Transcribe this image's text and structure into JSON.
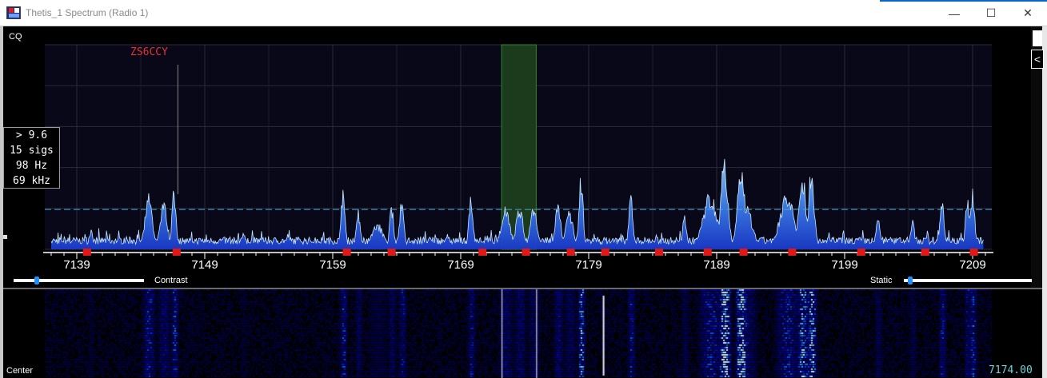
{
  "window": {
    "title": "Thetis_1 Spectrum (Radio 1)",
    "minimize_glyph": "—",
    "maximize_glyph": "☐",
    "close_glyph": "✕"
  },
  "panel": {
    "mode_label": "CQ",
    "collapse_glyph": "<",
    "callsign": "ZS6CCY",
    "center_label": "Center",
    "frequency": "7174.00"
  },
  "stats": {
    "threshold": "> 9.6",
    "signals": "15 sigs",
    "bin_width": "98 Hz",
    "span": "69 kHz"
  },
  "controls": {
    "contrast_label": "Contrast",
    "static_label": "Static",
    "contrast_value": 0.18,
    "static_value": 0.03
  },
  "colors": {
    "accent": "#1e90ff",
    "spectrum_fill": "#1a3acb",
    "spectrum_peak": "#8ed0ff",
    "passband": "#1c3a1c",
    "marker": "#e01818",
    "callsign": "#e83030",
    "readout": "#6fd0d8"
  },
  "chart_data": {
    "type": "area",
    "xlim": [
      7136.5,
      7210.5
    ],
    "ylim": [
      0,
      10
    ],
    "x_ticks": [
      7139,
      7149,
      7159,
      7169,
      7179,
      7189,
      7199,
      7209
    ],
    "passband": [
      7172.2,
      7174.9
    ],
    "threshold_line": 1.95,
    "markers": [
      7139.8,
      7146.8,
      7160.1,
      7163.6,
      7170.7,
      7174.1,
      7177.6,
      7180.3,
      7184.5,
      7188.3,
      7191.1,
      7194.9,
      7200.3,
      7205.3,
      7209.1
    ],
    "callsign_marker_x": 7146.9,
    "signals": [
      {
        "center": 7140.1,
        "width": 0.3,
        "level": 0.9
      },
      {
        "center": 7144.6,
        "width": 0.5,
        "level": 2.6
      },
      {
        "center": 7145.8,
        "width": 0.5,
        "level": 2.2
      },
      {
        "center": 7146.6,
        "width": 0.3,
        "level": 2.8
      },
      {
        "center": 7152.0,
        "width": 0.3,
        "level": 0.8
      },
      {
        "center": 7159.8,
        "width": 0.3,
        "level": 2.8
      },
      {
        "center": 7161.0,
        "width": 0.3,
        "level": 1.8
      },
      {
        "center": 7162.5,
        "width": 0.8,
        "level": 1.2
      },
      {
        "center": 7163.6,
        "width": 0.3,
        "level": 2.0
      },
      {
        "center": 7164.4,
        "width": 0.3,
        "level": 2.4
      },
      {
        "center": 7169.8,
        "width": 0.3,
        "level": 2.4
      },
      {
        "center": 7172.5,
        "width": 0.6,
        "level": 2.1
      },
      {
        "center": 7173.6,
        "width": 0.5,
        "level": 2.0
      },
      {
        "center": 7174.7,
        "width": 0.5,
        "level": 1.9
      },
      {
        "center": 7176.6,
        "width": 0.4,
        "level": 2.2
      },
      {
        "center": 7177.5,
        "width": 0.5,
        "level": 1.8
      },
      {
        "center": 7178.4,
        "width": 0.3,
        "level": 3.4
      },
      {
        "center": 7182.3,
        "width": 0.3,
        "level": 2.6
      },
      {
        "center": 7186.5,
        "width": 0.3,
        "level": 1.6
      },
      {
        "center": 7188.5,
        "width": 1.0,
        "level": 2.6
      },
      {
        "center": 7189.6,
        "width": 0.5,
        "level": 4.3
      },
      {
        "center": 7190.9,
        "width": 0.5,
        "level": 4.2
      },
      {
        "center": 7191.3,
        "width": 0.8,
        "level": 2.2
      },
      {
        "center": 7194.5,
        "width": 1.0,
        "level": 2.6
      },
      {
        "center": 7195.7,
        "width": 0.5,
        "level": 3.6
      },
      {
        "center": 7196.4,
        "width": 0.4,
        "level": 3.8
      },
      {
        "center": 7201.6,
        "width": 0.3,
        "level": 1.6
      },
      {
        "center": 7204.3,
        "width": 0.3,
        "level": 1.4
      },
      {
        "center": 7206.6,
        "width": 0.3,
        "level": 2.5
      },
      {
        "center": 7208.6,
        "width": 0.3,
        "level": 2.4
      },
      {
        "center": 7209.0,
        "width": 0.3,
        "level": 2.8
      }
    ]
  }
}
